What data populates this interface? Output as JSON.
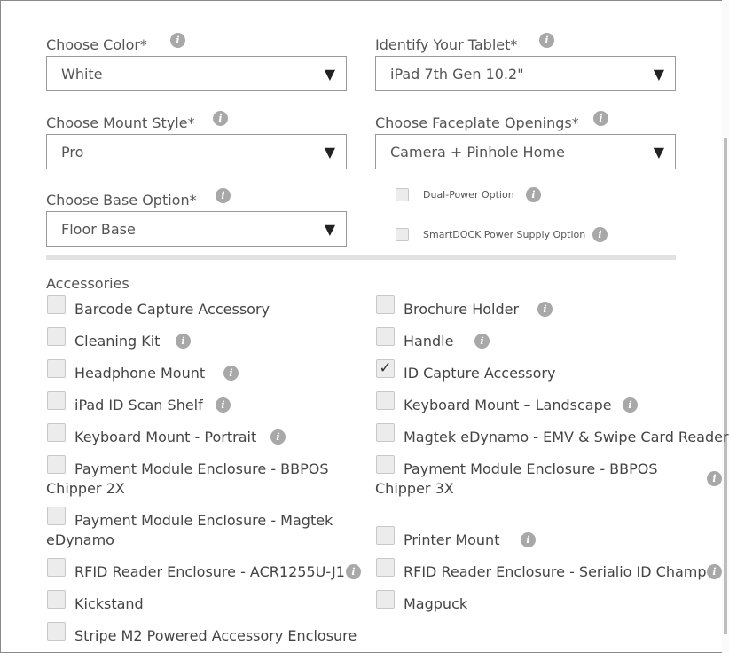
{
  "selects": {
    "color": {
      "label": "Choose Color*",
      "value": "White"
    },
    "tablet": {
      "label": "Identify Your Tablet*",
      "value": "iPad 7th Gen 10.2\""
    },
    "mount_style": {
      "label": "Choose Mount Style*",
      "value": "Pro"
    },
    "faceplate": {
      "label": "Choose Faceplate Openings*",
      "value": "Camera + Pinhole Home"
    },
    "base": {
      "label": "Choose Base Option*",
      "value": "Floor Base"
    }
  },
  "caret": "▼",
  "info_glyph": "i",
  "power_options": {
    "dual_power": {
      "label": "Dual-Power Option",
      "checked": false
    },
    "smartdock": {
      "label": "SmartDOCK Power Supply Option",
      "checked": false
    }
  },
  "accessories": {
    "heading": "Accessories",
    "check_glyph": "✓",
    "items": [
      {
        "label": "Barcode Capture Accessory",
        "checked": false
      },
      {
        "label": "Brochure Holder",
        "checked": false
      },
      {
        "label": "Cleaning Kit",
        "checked": false
      },
      {
        "label": "Handle",
        "checked": false
      },
      {
        "label": "Headphone Mount",
        "checked": false
      },
      {
        "label": "ID Capture Accessory",
        "checked": true
      },
      {
        "label": "iPad ID Scan Shelf",
        "checked": false
      },
      {
        "label": "Keyboard Mount – Landscape",
        "checked": false
      },
      {
        "label": "Keyboard Mount - Portrait",
        "checked": false
      },
      {
        "label": "Magtek eDynamo - EMV & Swipe Card Reader",
        "checked": false
      },
      {
        "label": "Payment Module Enclosure - BBPOS",
        "label_line2": "Chipper 2X",
        "checked": false
      },
      {
        "label": "Payment Module Enclosure - BBPOS",
        "label_line2": "Chipper 3X",
        "checked": false
      },
      {
        "label": "Payment Module Enclosure - Magtek",
        "label_line2": "eDynamo",
        "checked": false
      },
      {
        "label": "Printer Mount",
        "checked": false
      },
      {
        "label": "RFID Reader Enclosure - ACR1255U-J1",
        "checked": false
      },
      {
        "label": "RFID Reader Enclosure - Serialio ID Champ",
        "checked": false
      },
      {
        "label": "Kickstand",
        "checked": false
      },
      {
        "label": "Magpuck",
        "checked": false
      },
      {
        "label": "Stripe M2 Powered Accessory Enclosure",
        "checked": false
      }
    ]
  }
}
